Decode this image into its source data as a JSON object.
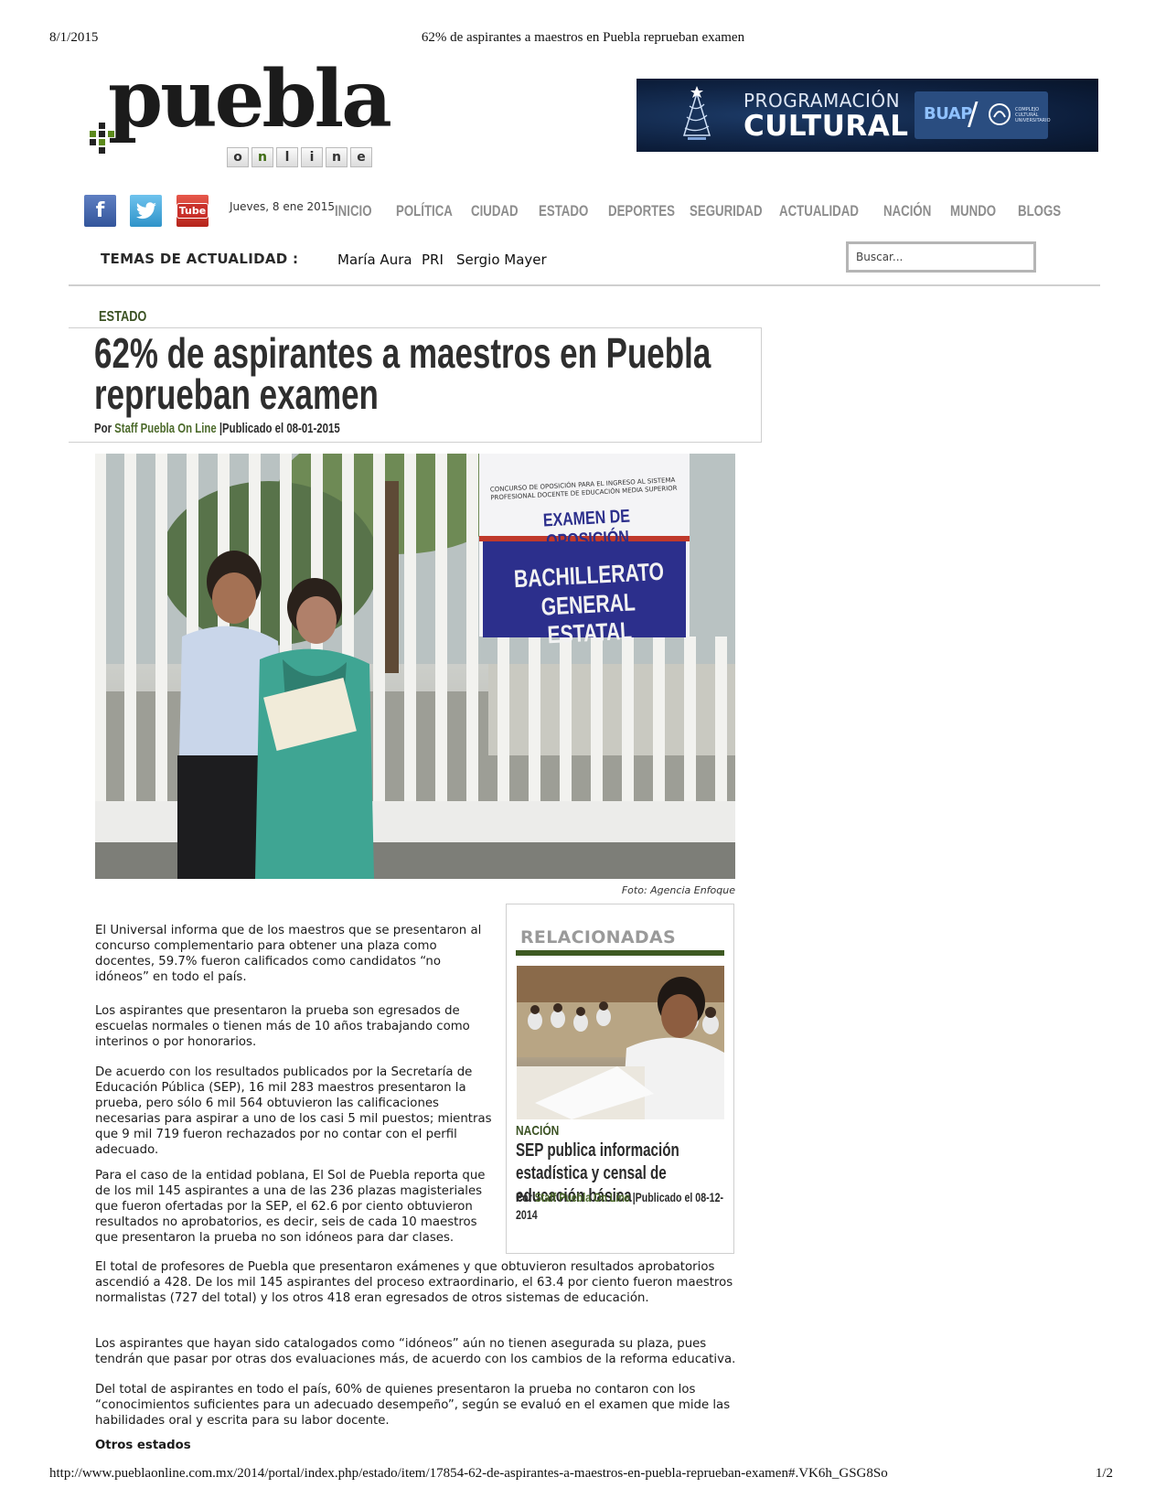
{
  "print_header": {
    "date": "8/1/2015",
    "title": "62% de aspirantes a maestros en Puebla reprueban examen"
  },
  "print_footer": {
    "url": "http://www.pueblaonline.com.mx/2014/portal/index.php/estado/item/17854-62-de-aspirantes-a-maestros-en-puebla-reprueban-examen#.VK6h_GSG8So",
    "page": "1/2"
  },
  "logo": {
    "word": "puebla",
    "online_letters": [
      "o",
      "n",
      "l",
      "i",
      "n",
      "e"
    ]
  },
  "banner": {
    "line1": "PROGRAMACIÓN",
    "line2": "CULTURAL",
    "brand": "BUAP",
    "brand_small": "COMPLEJO CULTURAL UNIVERSITARIO"
  },
  "social": {
    "facebook_label": "f",
    "youtube_label": "Tube"
  },
  "date_line": "Jueves, 8 ene 2015",
  "nav": [
    "INICIO",
    "POLÍTICA",
    "CIUDAD",
    "ESTADO",
    "DEPORTES",
    "SEGURIDAD",
    "ACTUALIDAD",
    "NACIÓN",
    "MUNDO",
    "BLOGS"
  ],
  "temas": {
    "label": "TEMAS DE ACTUALIDAD :",
    "items": [
      "María Aura",
      "PRI",
      "Sergio Mayer"
    ]
  },
  "search": {
    "placeholder": "Buscar..."
  },
  "article": {
    "section": "ESTADO",
    "title": "62% de aspirantes a maestros en Puebla reprueban examen",
    "byline_prefix": "Por ",
    "author": "Staff Puebla On Line",
    "published": "|Publicado el 08-01-2015",
    "photo_sign_small": "CONCURSO DE OPOSICIÓN PARA EL INGRESO AL SISTEMA PROFESIONAL DOCENTE DE EDUCACIÓN MEDIA SUPERIOR",
    "photo_sign_title": "EXAMEN DE OPOSICIÓN",
    "photo_sign_banner1": "BACHILLERATO",
    "photo_sign_banner2": "GENERAL ESTATAL",
    "photo_caption": "Foto: Agencia Enfoque",
    "paragraphs": [
      "El Universal informa que de los maestros que se presentaron al concurso complementario para obtener una plaza como docentes, 59.7% fueron calificados como candidatos “no idóneos” en todo el país.",
      "Los aspirantes que presentaron la prueba son egresados de escuelas normales o tienen más de 10 años trabajando como interinos o por honorarios.",
      "De acuerdo con los resultados publicados por la Secretaría de Educación Pública (SEP), 16 mil 283 maestros presentaron la prueba, pero sólo 6 mil 564 obtuvieron las calificaciones necesarias para aspirar a uno de los casi 5 mil puestos; mientras que 9 mil 719 fueron rechazados por no contar con el perfil adecuado.",
      "Para el caso de la entidad poblana, El Sol de Puebla reporta que de los mil 145 aspirantes a una de las 236 plazas magisteriales que fueron ofertadas por la SEP, el 62.6 por ciento obtuvieron resultados no aprobatorios, es decir, seis de cada 10 maestros que presentaron la prueba no son idóneos para dar clases.",
      "El total de profesores de Puebla que presentaron exámenes y que obtuvieron resultados aprobatorios ascendió a 428. De los mil 145 aspirantes del proceso extraordinario, el 63.4 por ciento fueron maestros normalistas (727 del total) y los otros 418 eran egresados de otros sistemas de educación.",
      "Los aspirantes que hayan sido catalogados como “idóneos” aún no tienen asegurada su plaza, pues tendrán que pasar por otras dos evaluaciones más, de acuerdo con los cambios de la reforma educativa.",
      "Del total de aspirantes en todo el país, 60% de quienes presentaron la prueba no contaron con los “conocimientos suficientes para un adecuado desempeño”, según se evaluó en el examen que mide las habilidades oral y escrita para su labor docente."
    ],
    "subheading": "Otros estados"
  },
  "related": {
    "title": "RELACIONADAS",
    "section": "NACIÓN",
    "headline": "SEP publica información estadística y censal de educación básica",
    "byline_prefix": "Por ",
    "author": "Staff Puebla On Line",
    "published": "|Publicado el 08-12-2014"
  },
  "colors": {
    "accent_green": "#3e5a22",
    "nav_gray": "#8d8d8d",
    "banner_navy": "#0c1d3a"
  }
}
